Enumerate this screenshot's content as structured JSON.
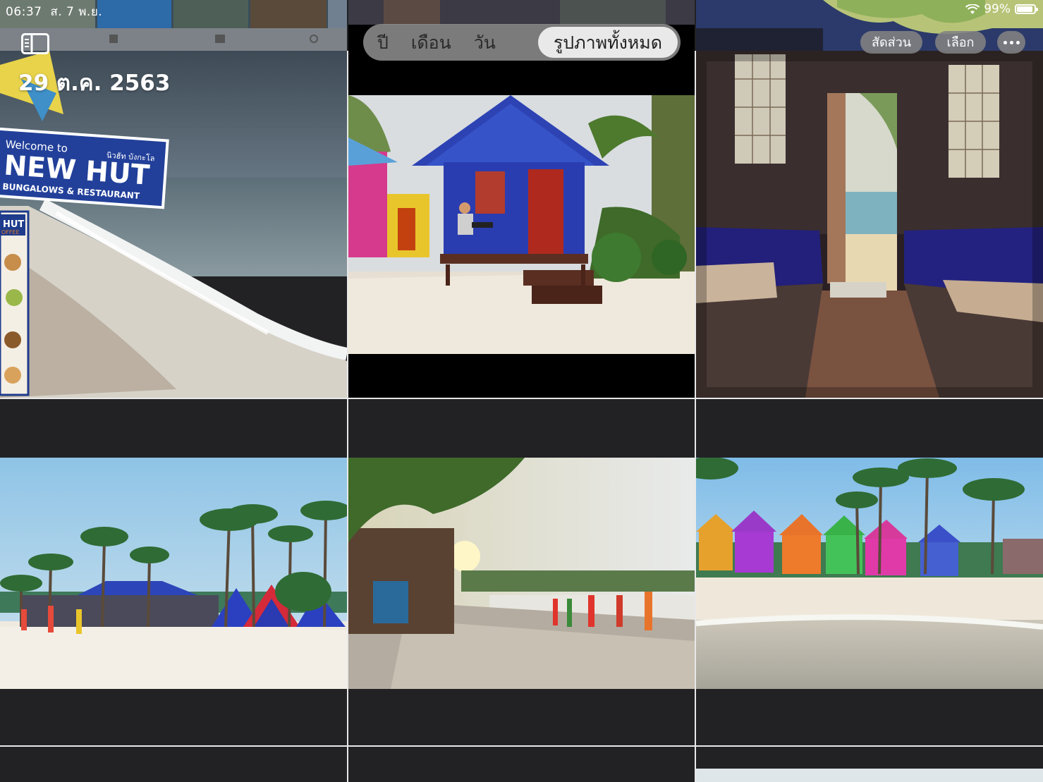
{
  "status": {
    "time": "06:37",
    "date": "ส. 7 พ.ย.",
    "battery_text": "99%",
    "battery_level": 0.99
  },
  "segmented": {
    "items": [
      "ปี",
      "เดือน",
      "วัน",
      "รูปภาพทั้งหมด"
    ],
    "selected": "รูปภาพทั้งหมด"
  },
  "toolbar": {
    "aspect_label": "สัดส่วน",
    "select_label": "เลือก"
  },
  "section": {
    "date": "29 ต.ค. 2563"
  },
  "photos": {
    "sign_line1": "Welcome to",
    "sign_line2": "NEW HUT",
    "sign_line3": "BUNGALOWS & RESTAURANT",
    "sign_thai": "นิวฮัท บังกะโล",
    "menu_title": "HUT",
    "menu_sub": "OFFEE"
  },
  "icons": [
    "sidebar-toggle-icon",
    "wifi-icon",
    "battery-icon",
    "more-icon"
  ],
  "colors": {
    "background": "#222225",
    "hut_blue": "#2b3fae",
    "accent_white": "#ffffff"
  }
}
